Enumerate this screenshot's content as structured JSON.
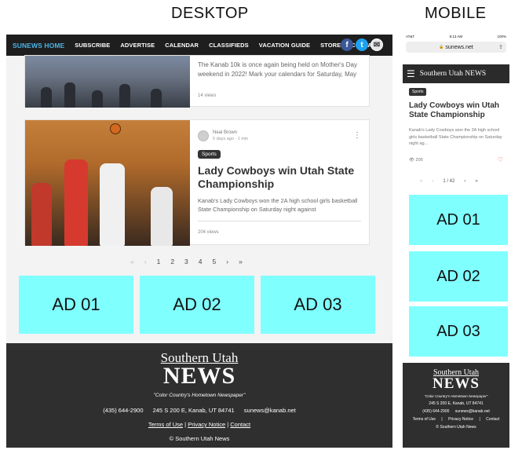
{
  "labels": {
    "desktop": "DESKTOP",
    "mobile": "MOBILE"
  },
  "desktop": {
    "nav": {
      "items": [
        "SUNEWS HOME",
        "SUBSCRIBE",
        "ADVERTISE",
        "CALENDAR",
        "CLASSIFIEDS",
        "VACATION GUIDE",
        "STORE",
        "CONTACT"
      ],
      "icons": {
        "facebook": "f",
        "twitter": "t",
        "mail": "✉"
      }
    },
    "card1": {
      "excerpt": "The Kanab 10k is once again being held on Mother's Day weekend in 2022! Mark your calendars for Saturday, May",
      "views": "14 views"
    },
    "card2": {
      "author": "Neal Brown",
      "meta": "5 days ago · 1 min",
      "tag": "Sports",
      "title": "Lady Cowboys win Utah State Championship",
      "excerpt": "Kanab's Lady Cowboys won the 2A high school girls basketball State Championship on Saturday night against",
      "views": "204 views",
      "more_icon": "⋮"
    },
    "pager": {
      "first": "«",
      "prev": "‹",
      "pages": [
        "1",
        "2",
        "3",
        "4",
        "5"
      ],
      "next": "›",
      "last": "»"
    },
    "ads": [
      "AD 01",
      "AD 02",
      "AD 03"
    ],
    "footer": {
      "logo_top": "Southern Utah",
      "logo_news": "NEWS",
      "tagline": "\"Color Country's Hometown Newspaper\"",
      "phone": "(435) 644-2900",
      "address": "245 S 200 E, Kanab, UT 84741",
      "email": "sunews@kanab.net",
      "terms": "Terms of Use",
      "privacy": "Privacy Notice",
      "contact": "Contact",
      "sep": "|",
      "copyright": "© Southern Utah News"
    }
  },
  "mobile": {
    "status": {
      "left": "AT&T",
      "center": "8:13 AM",
      "right": "100%"
    },
    "url": "sunews.net",
    "lock": "🔒",
    "share": "⇪",
    "menu_icon": "☰",
    "brand": "Southern Utah NEWS",
    "tag": "Sports",
    "title": "Lady Cowboys win Utah State Championship",
    "excerpt": "Kanab's Lady Cowboys won the 2A high school girls basketball State Championship on Saturday night ag...",
    "views": "👁 205",
    "heart": "♡",
    "pager": {
      "first": "«",
      "prev": "‹",
      "page": "1 / 42",
      "next": "›",
      "last": "»"
    },
    "ads": [
      "AD 01",
      "AD 02",
      "AD 03"
    ],
    "footer": {
      "logo_top": "Southern Utah",
      "logo_news": "NEWS",
      "tagline": "\"Color Country's Hometown Newspaper\"",
      "address": "245 S 200 E, Kanab, UT 84741",
      "phone": "(435) 644-2900",
      "email": "sunews@kanab.net",
      "terms": "Terms of Use",
      "privacy": "Privacy Notice",
      "contact": "Contact",
      "sep": "|",
      "copyright": "© Southern Utah News"
    }
  },
  "colors": {
    "ad_background": "#80ffff",
    "nav_background": "#1e1e1e",
    "footer_background": "#2f2f2f",
    "home_link": "#4fb3e6"
  }
}
